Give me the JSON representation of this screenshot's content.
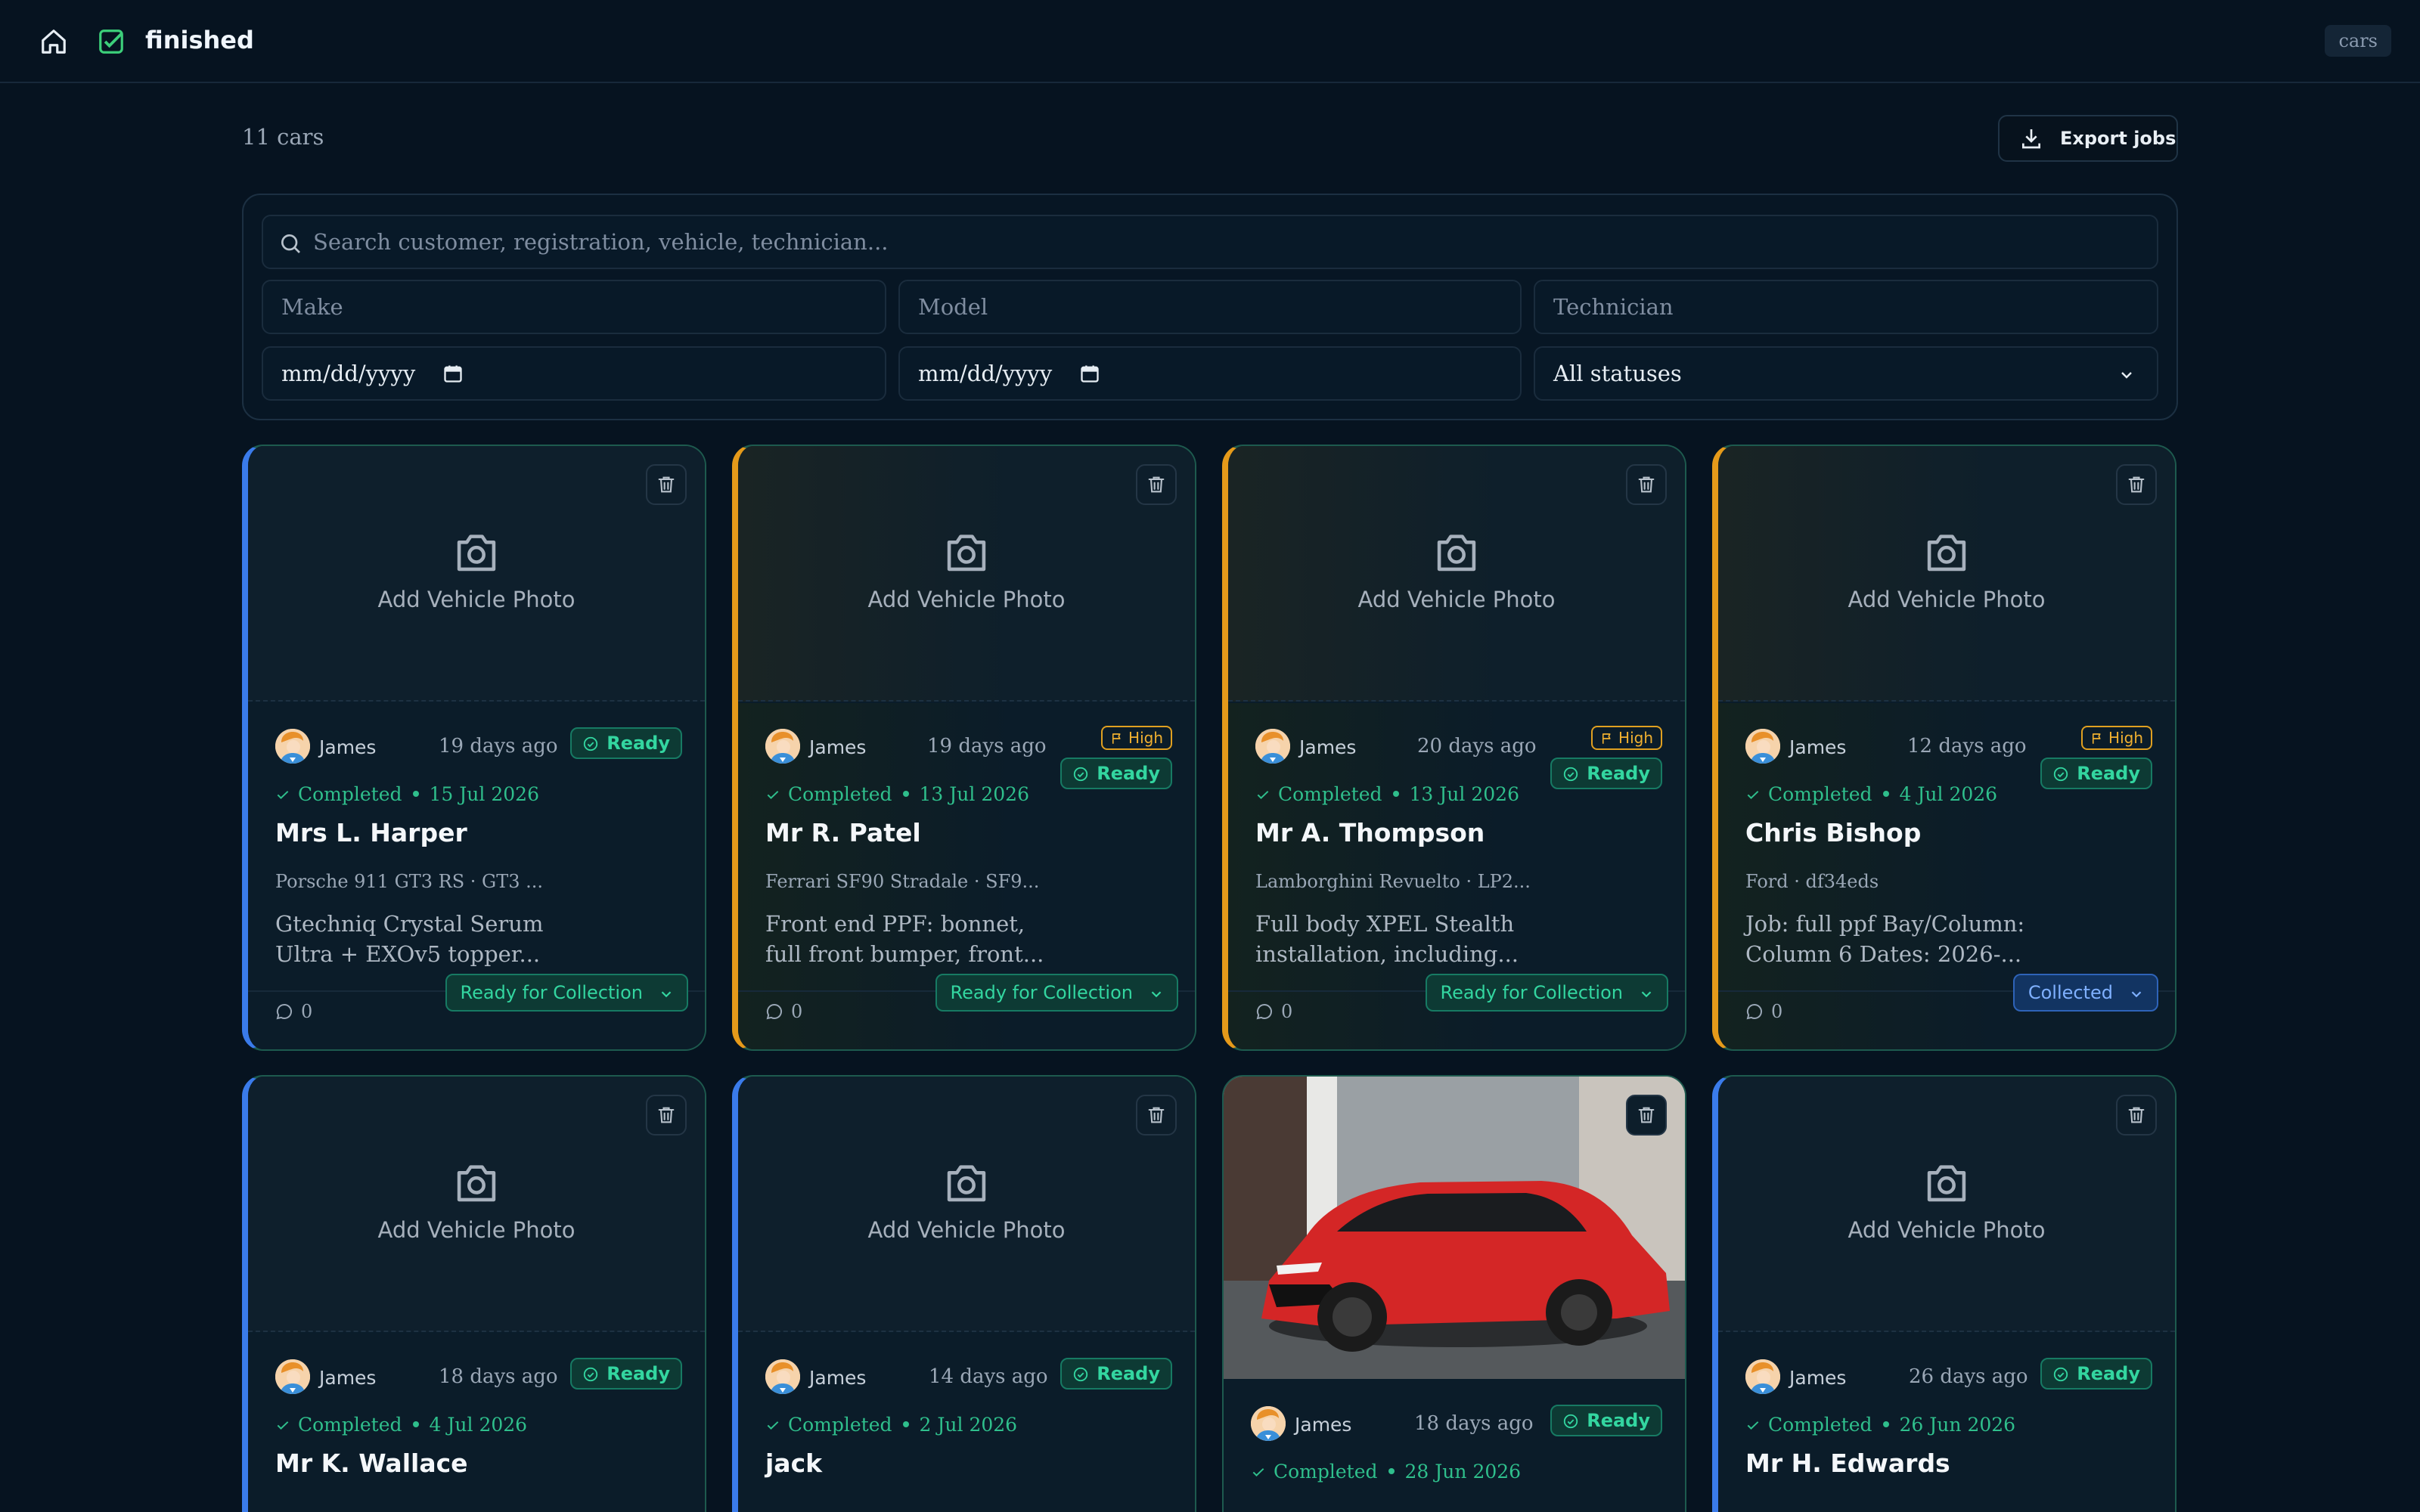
{
  "topbar": {
    "title": "finished",
    "route": "cars"
  },
  "header": {
    "count": "11 cars",
    "export_label": "Export jobs"
  },
  "filters": {
    "search_placeholder": "Search customer, registration, vehicle, technician...",
    "make_placeholder": "Make",
    "model_placeholder": "Model",
    "technician_placeholder": "Technician",
    "date_from": "mm/dd/yyyy",
    "date_to": "mm/dd/yyyy",
    "status": "All statuses"
  },
  "common": {
    "add_photo": "Add Vehicle Photo",
    "ready": "Ready",
    "high": "High",
    "completed": "Completed"
  },
  "cards": [
    {
      "technician": "James",
      "ago": "19 days ago",
      "date": "15 Jul 2026",
      "customer": "Mrs L. Harper",
      "vehicle": "Porsche 911 GT3 RS · GT3 ...",
      "desc1": "Gtechniq Crystal Serum",
      "desc2": "Ultra + EXOv5 topper...",
      "comments": "0",
      "status": "Ready for Collection"
    },
    {
      "technician": "James",
      "ago": "19 days ago",
      "date": "13 Jul 2026",
      "customer": "Mr R. Patel",
      "vehicle": "Ferrari SF90 Stradale · SF9...",
      "desc1": "Front end PPF: bonnet,",
      "desc2": "full front bumper, front...",
      "comments": "0",
      "status": "Ready for Collection"
    },
    {
      "technician": "James",
      "ago": "20 days ago",
      "date": "13 Jul 2026",
      "customer": "Mr A. Thompson",
      "vehicle": "Lamborghini Revuelto · LP2...",
      "desc1": "Full body XPEL Stealth",
      "desc2": "installation, including...",
      "comments": "0",
      "status": "Ready for Collection"
    },
    {
      "technician": "James",
      "ago": "12 days ago",
      "date": "4 Jul 2026",
      "customer": "Chris Bishop",
      "vehicle": "Ford · df34eds",
      "desc1": "Job: full ppf Bay/Column:",
      "desc2": "Column 6 Dates: 2026-...",
      "comments": "0",
      "status": "Collected"
    },
    {
      "technician": "James",
      "ago": "18 days ago",
      "date": "4 Jul 2026",
      "customer": "Mr K. Wallace"
    },
    {
      "technician": "James",
      "ago": "14 days ago",
      "date": "2 Jul 2026",
      "customer": "jack"
    },
    {
      "technician": "James",
      "ago": "18 days ago",
      "date": "28 Jun 2026",
      "customer": ""
    },
    {
      "technician": "James",
      "ago": "26 days ago",
      "date": "26 Jun 2026",
      "customer": "Mr H. Edwards"
    }
  ]
}
